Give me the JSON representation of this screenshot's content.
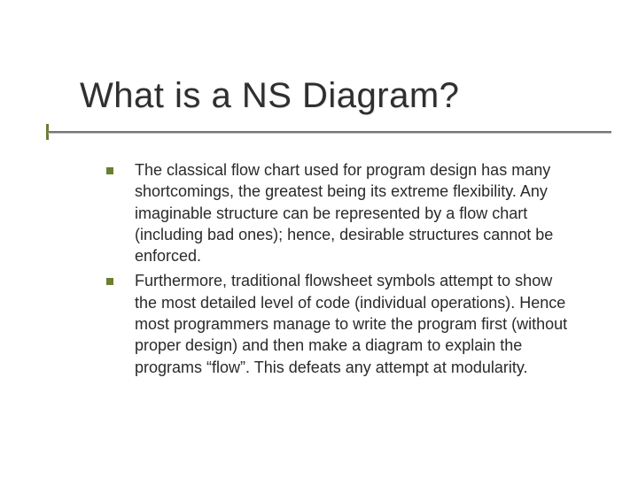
{
  "slide": {
    "title": "What is a NS Diagram?",
    "bullets": [
      {
        "text": "The classical flow chart used for program design has many shortcomings, the greatest being its extreme flexibility. Any imaginable structure can be represented by a flow chart (including bad ones); hence, desirable structures cannot be enforced."
      },
      {
        "text": "Furthermore, traditional flowsheet symbols attempt to show the most detailed level of code (individual operations).  Hence most programmers manage to write the program first (without proper design) and then make a diagram to explain the programs “flow”. This defeats any attempt at modularity."
      }
    ]
  }
}
